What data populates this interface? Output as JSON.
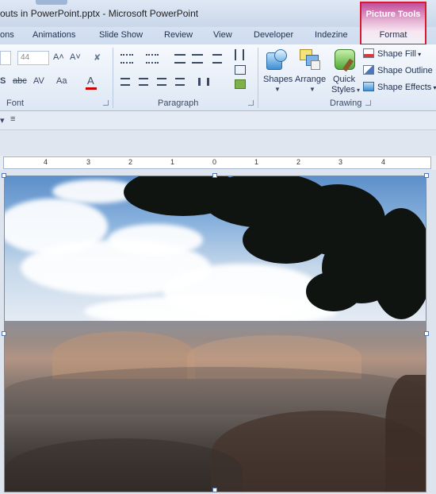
{
  "window": {
    "title": "outs in PowerPoint.pptx  -  Microsoft PowerPoint"
  },
  "contextual_tab": {
    "group": "Picture Tools",
    "tab": "Format"
  },
  "tabs": [
    "ons",
    "Animations",
    "Slide Show",
    "Review",
    "View",
    "Developer",
    "Indezine"
  ],
  "ribbon": {
    "font": {
      "label": "Font",
      "size_value": "44",
      "grow_glyph": "A˄",
      "shrink_glyph": "A˅",
      "clear_glyph": "✘",
      "shadow_glyph": "S",
      "strike_glyph": "abc",
      "spacing_glyph": "AV",
      "case_glyph": "Aa",
      "color_glyph": "A"
    },
    "paragraph": {
      "label": "Paragraph"
    },
    "drawing": {
      "label": "Drawing",
      "shapes": "Shapes",
      "arrange": "Arrange",
      "quick_styles_1": "Quick",
      "quick_styles_2": "Styles",
      "shape_fill": "Shape Fill",
      "shape_outline": "Shape Outline",
      "shape_effects": "Shape Effects"
    }
  },
  "qat": {
    "arrow1": "▾",
    "arrow2": "≡"
  },
  "ruler": {
    "labels": [
      "4",
      "3",
      "2",
      "1",
      "0",
      "1",
      "2",
      "3",
      "4"
    ]
  },
  "colors": {
    "context_highlight": "#d8192e",
    "context_tab_top": "#c34d9b",
    "ribbon_bg": "#f6f9fd"
  },
  "icons": {
    "shapes": "shapes-icon",
    "arrange": "arrange-icon",
    "quick_styles": "quick-styles-icon",
    "shape_fill": "paint-bucket-icon",
    "shape_outline": "pencil-icon",
    "shape_effects": "effects-icon"
  }
}
